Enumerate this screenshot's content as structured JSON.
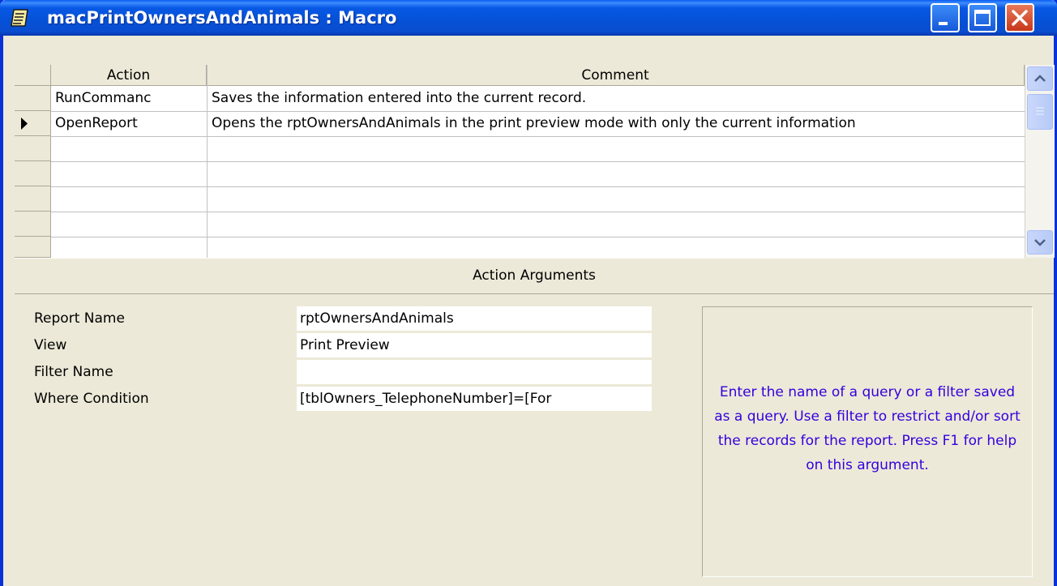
{
  "window": {
    "title": "macPrintOwnersAndAnimals : Macro",
    "icon": "macro-scroll-icon"
  },
  "grid": {
    "columns": [
      "Action",
      "Comment"
    ],
    "rows": [
      {
        "action": "RunCommanc",
        "comment": "Saves the information entered into the current record.",
        "current": false
      },
      {
        "action": "OpenReport",
        "comment": "Opens the rptOwnersAndAnimals in the print preview mode with only the current information",
        "current": true
      },
      {
        "action": "",
        "comment": ""
      },
      {
        "action": "",
        "comment": ""
      },
      {
        "action": "",
        "comment": ""
      },
      {
        "action": "",
        "comment": ""
      },
      {
        "action": "",
        "comment": ""
      }
    ]
  },
  "arguments": {
    "title": "Action Arguments",
    "fields": [
      {
        "label": "Report Name",
        "value": "rptOwnersAndAnimals"
      },
      {
        "label": "View",
        "value": "Print Preview"
      },
      {
        "label": "Filter Name",
        "value": ""
      },
      {
        "label": "Where Condition",
        "value": "[tblOwners_TelephoneNumber]=[For"
      }
    ],
    "help": "Enter the name of a query or a filter saved as a query. Use a filter to restrict and/or sort the records for the report. Press F1 for help on this argument."
  },
  "colors": {
    "titlebar": "#0551d6",
    "help_text": "#3300dd",
    "frame": "#ece9d8"
  }
}
